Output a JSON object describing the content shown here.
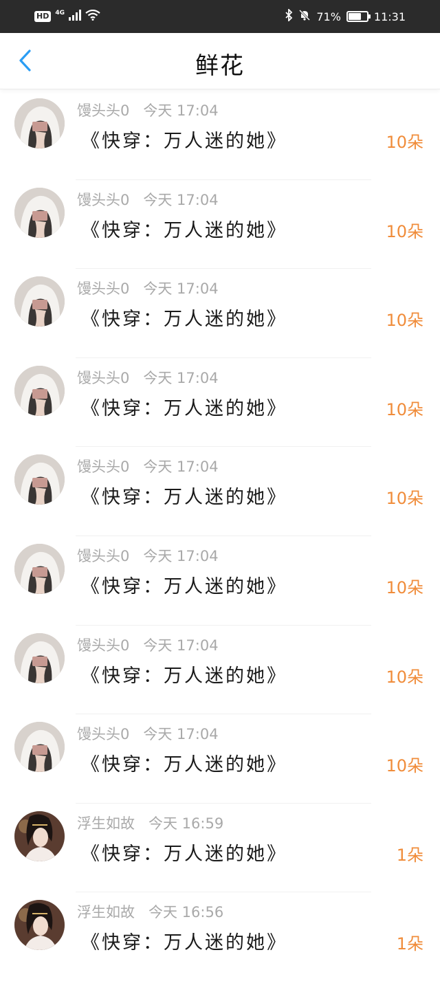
{
  "status_bar": {
    "hd": "HD",
    "network": "4G",
    "battery_text": "71%",
    "battery_level": 0.71,
    "time": "11:31"
  },
  "header": {
    "title": "鲜花",
    "back_icon": "chevron-left-icon",
    "accent_color": "#2a9df4"
  },
  "items": [
    {
      "user": "馒头头0",
      "time": "今天 17:04",
      "book": "《快穿：万人迷的她》",
      "count": "10朵",
      "avatar": "white-hood"
    },
    {
      "user": "馒头头0",
      "time": "今天 17:04",
      "book": "《快穿：万人迷的她》",
      "count": "10朵",
      "avatar": "white-hood"
    },
    {
      "user": "馒头头0",
      "time": "今天 17:04",
      "book": "《快穿：万人迷的她》",
      "count": "10朵",
      "avatar": "white-hood"
    },
    {
      "user": "馒头头0",
      "time": "今天 17:04",
      "book": "《快穿：万人迷的她》",
      "count": "10朵",
      "avatar": "white-hood"
    },
    {
      "user": "馒头头0",
      "time": "今天 17:04",
      "book": "《快穿：万人迷的她》",
      "count": "10朵",
      "avatar": "white-hood"
    },
    {
      "user": "馒头头0",
      "time": "今天 17:04",
      "book": "《快穿：万人迷的她》",
      "count": "10朵",
      "avatar": "white-hood"
    },
    {
      "user": "馒头头0",
      "time": "今天 17:04",
      "book": "《快穿：万人迷的她》",
      "count": "10朵",
      "avatar": "white-hood"
    },
    {
      "user": "馒头头0",
      "time": "今天 17:04",
      "book": "《快穿：万人迷的她》",
      "count": "10朵",
      "avatar": "white-hood"
    },
    {
      "user": "浮生如故",
      "time": "今天 16:59",
      "book": "《快穿：万人迷的她》",
      "count": "1朵",
      "avatar": "costume-girl"
    },
    {
      "user": "浮生如故",
      "time": "今天 16:56",
      "book": "《快穿：万人迷的她》",
      "count": "1朵",
      "avatar": "costume-girl"
    }
  ],
  "count_color": "#f08c3a"
}
